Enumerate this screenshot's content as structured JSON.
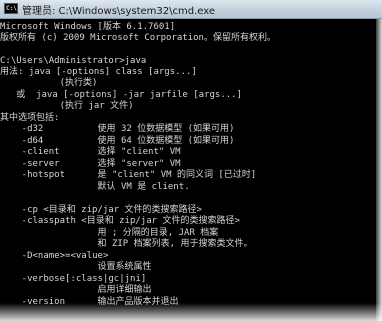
{
  "window": {
    "title": "管理员: C:\\Windows\\system32\\cmd.exe",
    "icon": "cmd-icon"
  },
  "console": {
    "lines": [
      "Microsoft Windows [版本 6.1.7601]",
      "版权所有 (c) 2009 Microsoft Corporation。保留所有权利。",
      "",
      "C:\\Users\\Administrator>java",
      "用法: java [-options] class [args...]",
      "           (执行类)",
      "   或  java [-options] -jar jarfile [args...]",
      "           (执行 jar 文件)",
      "其中选项包括:",
      "    -d32          使用 32 位数据模型 (如果可用)",
      "    -d64          使用 64 位数据模型 (如果可用)",
      "    -client       选择 \"client\" VM",
      "    -server       选择 \"server\" VM",
      "    -hotspot      是 \"client\" VM 的同义词 [已过时]",
      "                  默认 VM 是 client.",
      "",
      "    -cp <目录和 zip/jar 文件的类搜索路径>",
      "    -classpath <目录和 zip/jar 文件的类搜索路径>",
      "                  用 ; 分隔的目录, JAR 档案",
      "                  和 ZIP 档案列表, 用于搜索类文件。",
      "    -D<name>=<value>",
      "                  设置系统属性",
      "    -verbose[:class|gc|jni]",
      "                  启用详细输出",
      "    -version      输出产品版本并退出"
    ]
  }
}
